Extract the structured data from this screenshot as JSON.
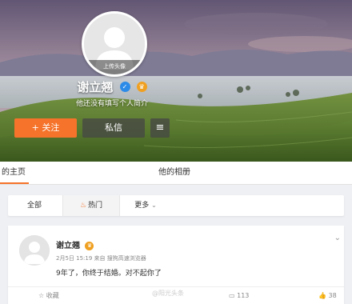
{
  "profile": {
    "avatar_hint": "上传头像",
    "name": "谢立翘",
    "bio": "他还没有填写个人简介",
    "follow_label": "+ 关注",
    "message_label": "私信",
    "menu_icon": "hamburger-icon",
    "badge_blue_icon": "verified-badge-icon",
    "badge_gold_icon": "vip-crown-icon"
  },
  "tabs": {
    "home": "的主页",
    "album": "他的相册"
  },
  "filter": {
    "all": "全部",
    "hot": "热门",
    "more": "更多"
  },
  "post": {
    "author": "谢立翘",
    "meta": "2月5日 15:19 来自 搜狗高速浏览器",
    "text": "9年了，你终于结婚。对不起你了",
    "favorite_label": "收藏",
    "comment_count": "113",
    "like_count": "38",
    "watermark": "@阳光头条"
  },
  "colors": {
    "accent": "#f5732a",
    "dark_button": "#464646"
  }
}
